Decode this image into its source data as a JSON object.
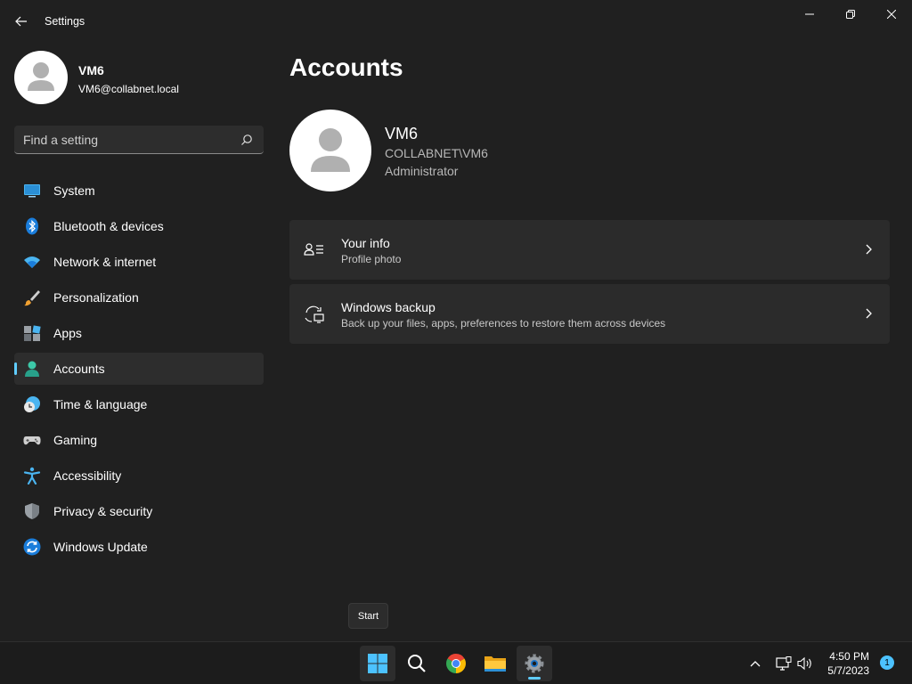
{
  "window": {
    "title": "Settings"
  },
  "user": {
    "name": "VM6",
    "email": "VM6@collabnet.local"
  },
  "search": {
    "placeholder": "Find a setting"
  },
  "sidebar": {
    "items": [
      {
        "label": "System",
        "icon": "system-icon"
      },
      {
        "label": "Bluetooth & devices",
        "icon": "bluetooth-icon"
      },
      {
        "label": "Network & internet",
        "icon": "wifi-icon"
      },
      {
        "label": "Personalization",
        "icon": "brush-icon"
      },
      {
        "label": "Apps",
        "icon": "apps-icon"
      },
      {
        "label": "Accounts",
        "icon": "account-icon",
        "active": true
      },
      {
        "label": "Time & language",
        "icon": "clock-globe-icon"
      },
      {
        "label": "Gaming",
        "icon": "gamepad-icon"
      },
      {
        "label": "Accessibility",
        "icon": "accessibility-icon"
      },
      {
        "label": "Privacy & security",
        "icon": "shield-icon"
      },
      {
        "label": "Windows Update",
        "icon": "update-icon"
      }
    ]
  },
  "main": {
    "title": "Accounts",
    "account": {
      "name": "VM6",
      "domain": "COLLABNET\\VM6",
      "role": "Administrator"
    },
    "cards": [
      {
        "title": "Your info",
        "subtitle": "Profile photo",
        "icon": "person-info-icon"
      },
      {
        "title": "Windows backup",
        "subtitle": "Back up your files, apps, preferences to restore them across devices",
        "icon": "backup-icon"
      }
    ]
  },
  "tooltip": {
    "text": "Start"
  },
  "taskbar": {
    "apps": [
      "start-icon",
      "search-icon",
      "chrome-icon",
      "file-explorer-icon",
      "settings-icon"
    ],
    "time": "4:50 PM",
    "date": "5/7/2023",
    "notification_count": "1"
  },
  "colors": {
    "background": "#202020",
    "accent": "#60cdff",
    "card": "#2b2b2b"
  }
}
